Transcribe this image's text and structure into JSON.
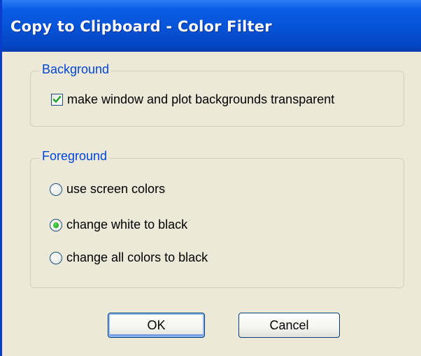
{
  "window": {
    "title": "Copy to Clipboard - Color Filter"
  },
  "background_group": {
    "legend": "Background",
    "checkbox": {
      "label": "make window and plot backgrounds transparent",
      "checked": true
    }
  },
  "foreground_group": {
    "legend": "Foreground",
    "options": [
      {
        "label": "use screen colors",
        "selected": false
      },
      {
        "label": "change white to black",
        "selected": true
      },
      {
        "label": "change all colors to black",
        "selected": false
      }
    ]
  },
  "buttons": {
    "ok_label": "OK",
    "cancel_label": "Cancel"
  },
  "colors": {
    "titlebar": "#0654d8",
    "dialog_bg": "#ece9d8",
    "legend_text": "#0046d5",
    "radio_selected": "#21a121",
    "checkmark": "#21a121"
  }
}
